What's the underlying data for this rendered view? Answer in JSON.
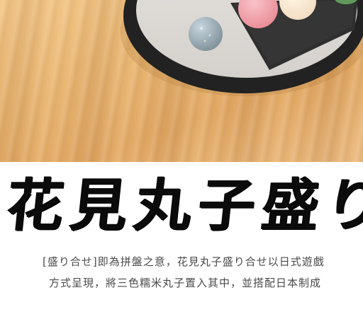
{
  "article": {
    "title": "花見丸子盛り",
    "paragraph_lines": [
      "[盛り合せ]即為拼盤之意，花見丸子盛り合せ以日式遊戲",
      "方式呈現，將三色糯米丸子置入其中，並搭配日本制成"
    ]
  }
}
